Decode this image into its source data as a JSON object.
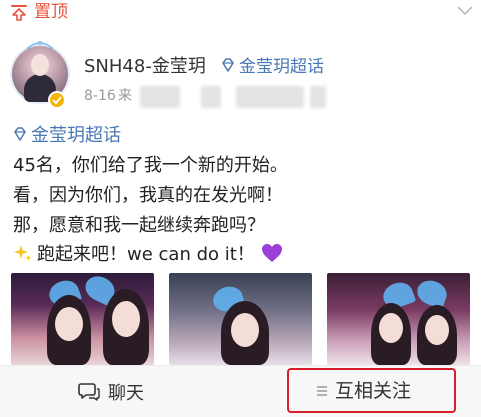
{
  "pin_bar": {
    "label": "置顶",
    "icon": "pin-top-icon",
    "accent": "#e8553d"
  },
  "author": {
    "name": "SNH48-金莹玥",
    "supertopic": "金莹玥超话",
    "date": "8-16",
    "source_fragment": "来"
  },
  "post": {
    "topic_link": "金莹玥超话",
    "lines": [
      "45名，你们给了我一个新的开始。",
      "看，因为你们，我真的在发光啊！",
      "那，愿意和我一起继续奔跑吗？",
      "跑起来吧！we can do it！"
    ],
    "emoji": {
      "sparkle": "sparkles-icon",
      "heart": "purple-heart-icon"
    }
  },
  "photos": [
    "photo-1",
    "photo-2",
    "photo-3"
  ],
  "bottom_bar": {
    "chat_label": "聊天",
    "follow_label": "互相关注"
  },
  "colors": {
    "link": "#4a78b6",
    "highlight_border": "#d81e2a"
  }
}
